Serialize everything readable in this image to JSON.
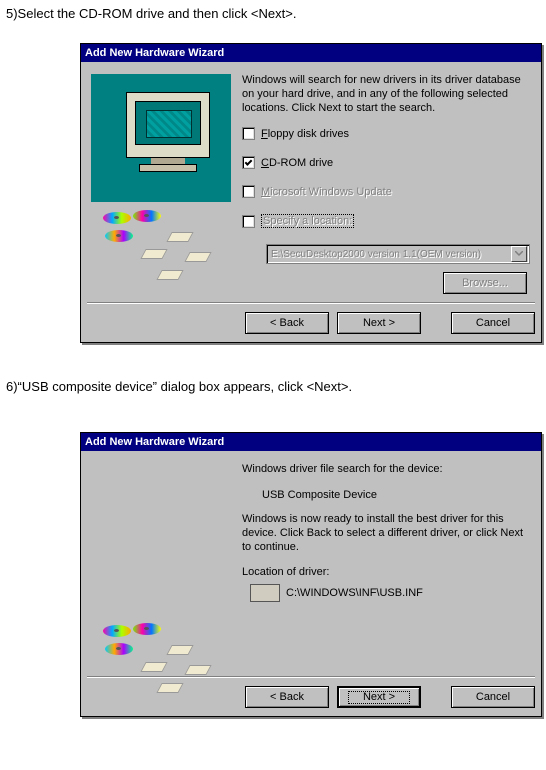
{
  "step5": {
    "instruction": "5)Select the CD-ROM drive and then click <Next>.",
    "dialog": {
      "title": "Add New Hardware Wizard",
      "description": "Windows will search for new drivers in its driver database on your hard drive, and in any of the following selected locations. Click Next to start the search.",
      "checkboxes": {
        "floppy": {
          "letter": "F",
          "rest": "loppy disk drives",
          "checked": false,
          "enabled": true
        },
        "cdrom": {
          "letter": "C",
          "rest": "D-ROM drive",
          "checked": true,
          "enabled": true
        },
        "msupdate": {
          "letter": "M",
          "rest": "icrosoft Windows Update",
          "checked": false,
          "enabled": false
        },
        "specify": {
          "label": "Specify a location:",
          "checked": false,
          "enabled": false
        }
      },
      "combo_value": "E:\\SecuDesktop2000 version 1.1(OEM version)",
      "browse": "Browse...",
      "buttons": {
        "back": "< Back",
        "next": "Next >",
        "cancel": "Cancel"
      }
    }
  },
  "step6": {
    "instruction": "6)“USB composite device” dialog box appears, click <Next>.",
    "dialog": {
      "title": "Add New Hardware Wizard",
      "search_line": "Windows driver file search for the device:",
      "device": "USB Composite Device",
      "ready_line": "Windows is now ready to install the best driver for this device. Click Back to select a different driver, or click Next to continue.",
      "location_label": "Location of driver:",
      "location_path": "C:\\WINDOWS\\INF\\USB.INF",
      "buttons": {
        "back": "< Back",
        "next": "Next >",
        "cancel": "Cancel"
      }
    }
  }
}
